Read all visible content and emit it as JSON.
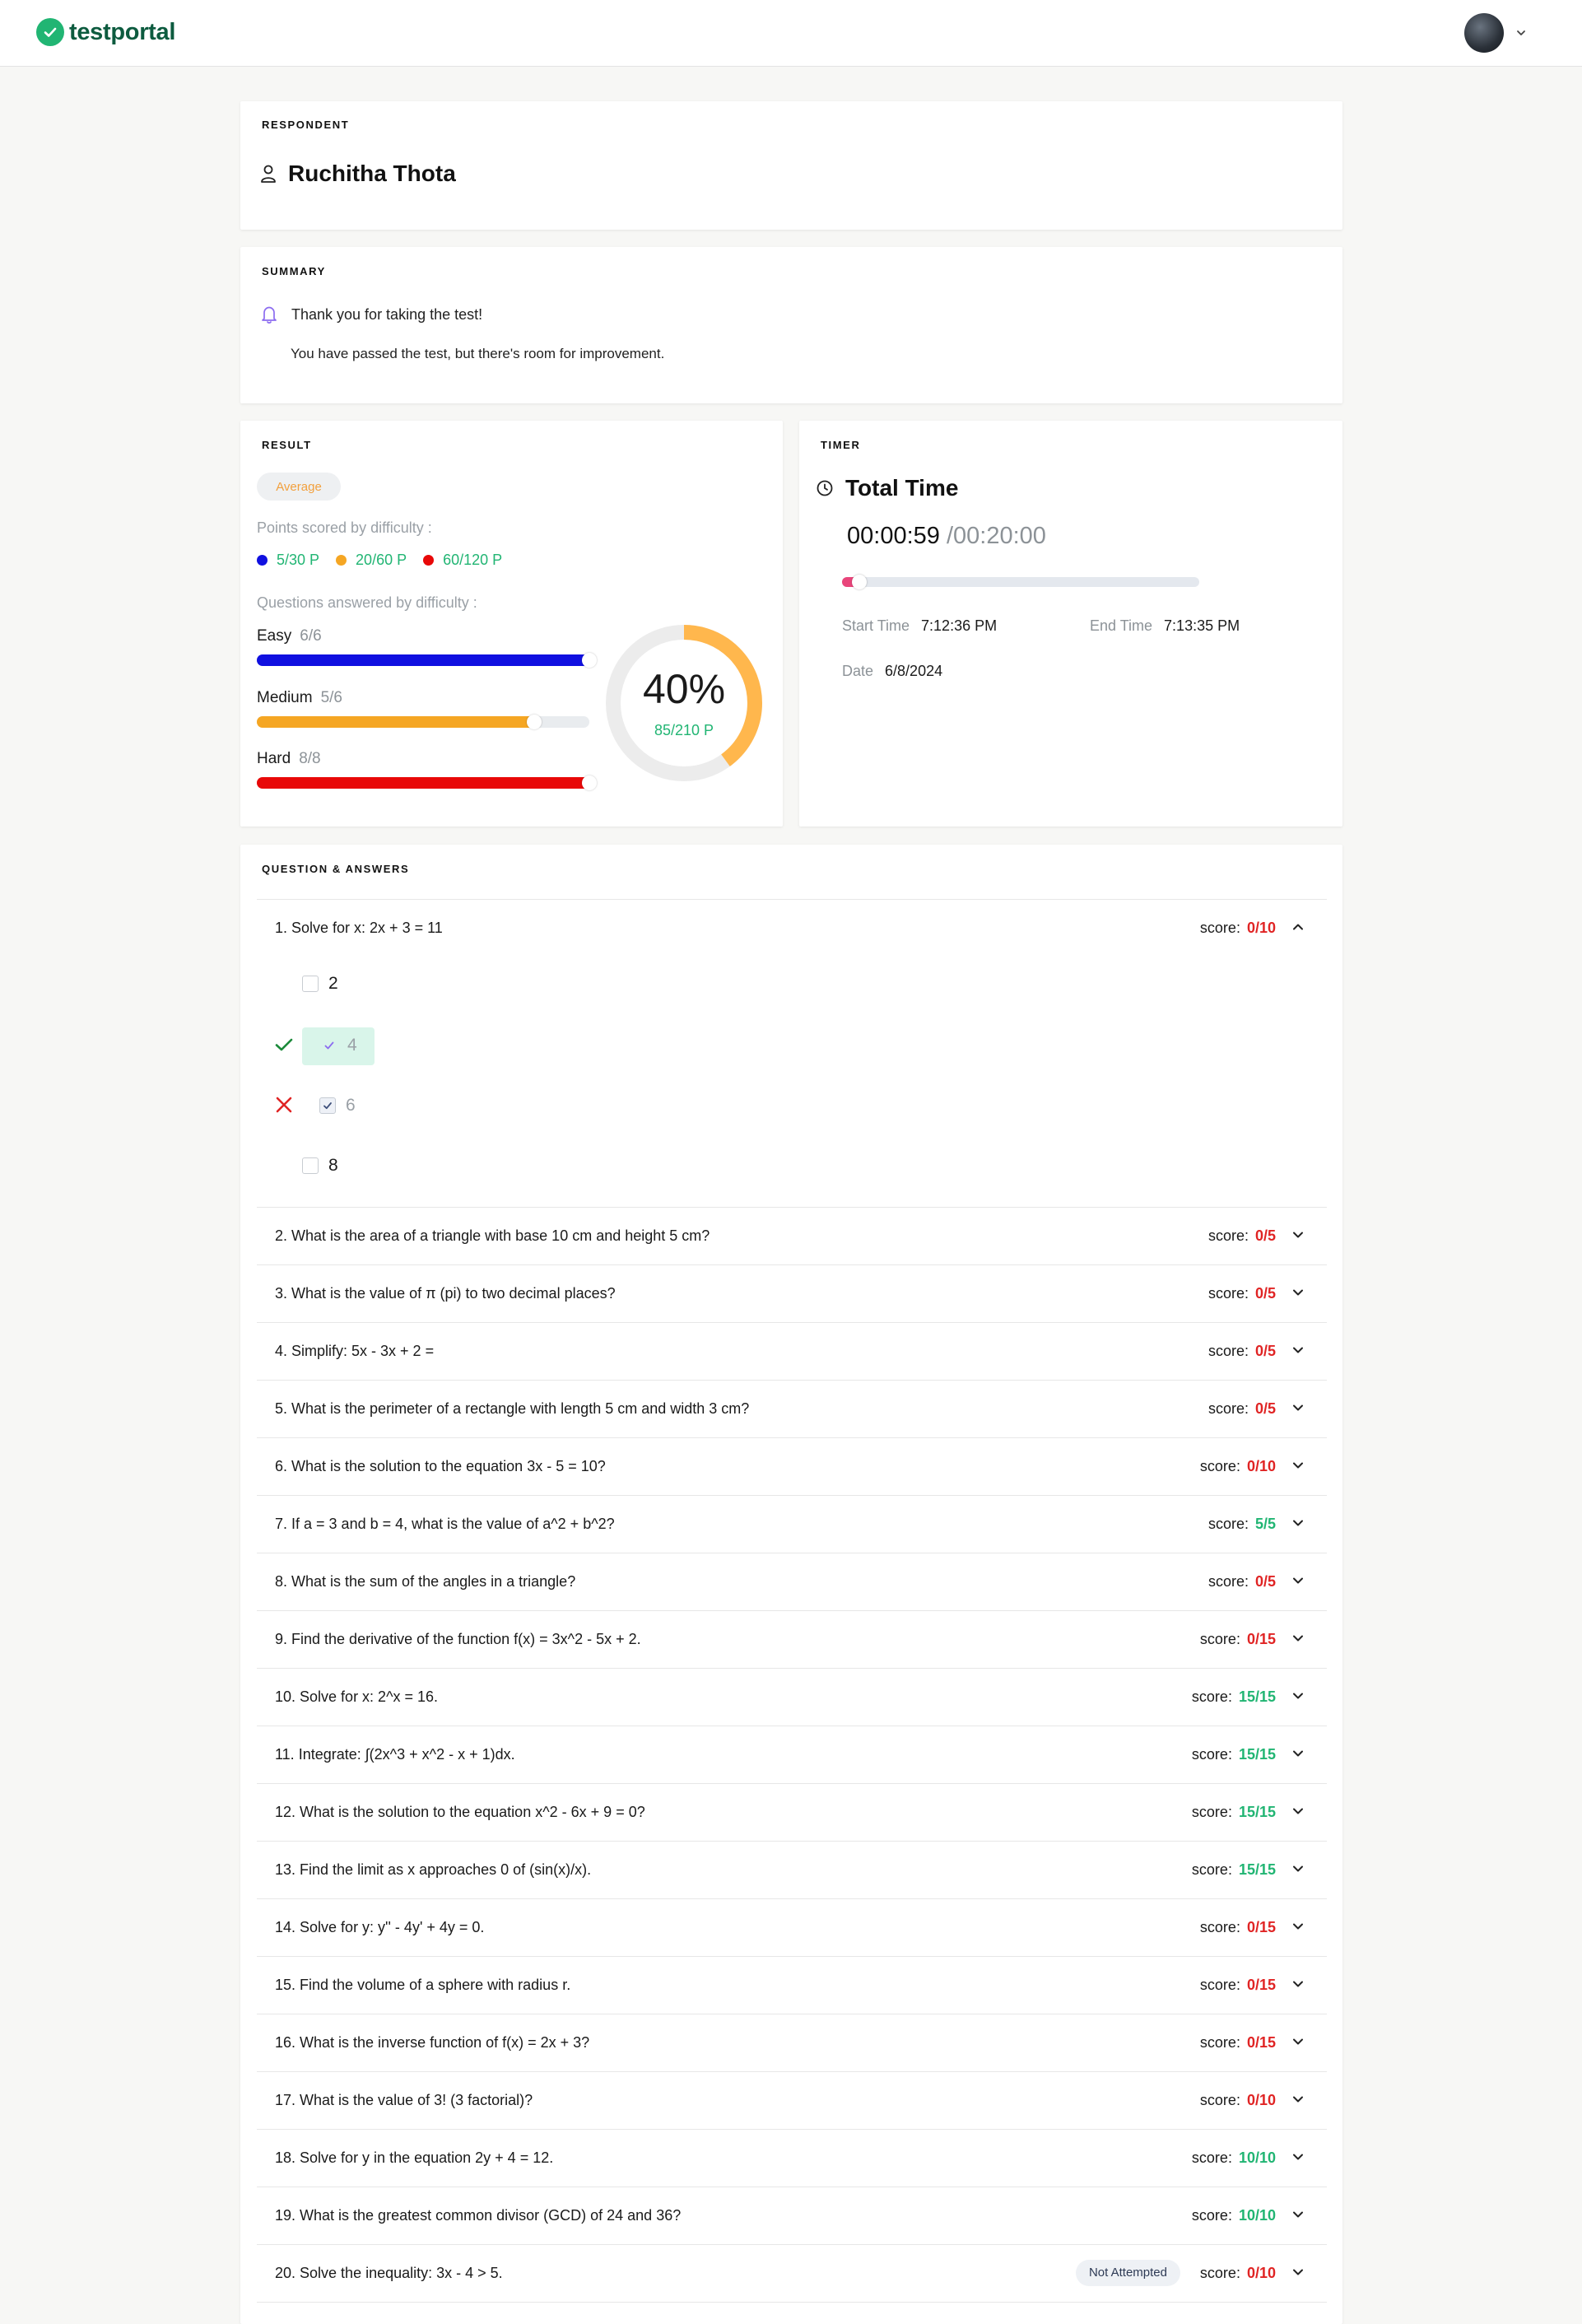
{
  "app": {
    "name": "testportal"
  },
  "respondent": {
    "label": "RESPONDENT",
    "name": "Ruchitha Thota"
  },
  "summary": {
    "label": "SUMMARY",
    "line1": "Thank you for taking the test!",
    "line2": "You have passed the test, but there's room for improvement."
  },
  "result": {
    "label": "RESULT",
    "badge": "Average",
    "points_label": "Points scored by difficulty :",
    "points": [
      {
        "value": "5/30 P",
        "color": "#1010e0"
      },
      {
        "value": "20/60 P",
        "color": "#f5a623"
      },
      {
        "value": "60/120 P",
        "color": "#e80808"
      }
    ],
    "questions_label": "Questions answered by difficulty :",
    "difficulties": [
      {
        "name": "Easy",
        "fraction": "6/6",
        "progress": 1.0,
        "color": "#1010e0"
      },
      {
        "name": "Medium",
        "fraction": "5/6",
        "progress": 0.833,
        "color": "#f5a623"
      },
      {
        "name": "Hard",
        "fraction": "8/8",
        "progress": 1.0,
        "color": "#e80808"
      }
    ],
    "percent": "40%",
    "percent_value": 0.4,
    "points_total": "85/210 P",
    "donut_color": "#ffb74d"
  },
  "timer": {
    "label": "TIMER",
    "title": "Total Time",
    "elapsed": "00:00:59",
    "total": "/00:20:00",
    "start_label": "Start Time",
    "start_value": "7:12:36 PM",
    "end_label": "End Time",
    "end_value": "7:13:35 PM",
    "date_label": "Date",
    "date_value": "6/8/2024"
  },
  "qa": {
    "label": "QUESTION & ANSWERS",
    "score_label": "score:",
    "not_attempted": "Not Attempted",
    "q1_options": [
      "2",
      "4",
      "6",
      "8"
    ],
    "questions": [
      {
        "text": "1. Solve for x: 2x + 3 = 11",
        "score": "0/10",
        "state": "red"
      },
      {
        "text": "2. What is the area of a triangle with base 10 cm and height 5 cm?",
        "score": "0/5",
        "state": "red"
      },
      {
        "text": "3. What is the value of π (pi) to two decimal places?",
        "score": "0/5",
        "state": "red"
      },
      {
        "text": "4. Simplify: 5x - 3x + 2 =",
        "score": "0/5",
        "state": "red"
      },
      {
        "text": "5. What is the perimeter of a rectangle with length 5 cm and width 3 cm?",
        "score": "0/5",
        "state": "red"
      },
      {
        "text": "6. What is the solution to the equation 3x - 5 = 10?",
        "score": "0/10",
        "state": "red"
      },
      {
        "text": "7. If a = 3 and b = 4, what is the value of a^2 + b^2?",
        "score": "5/5",
        "state": "green"
      },
      {
        "text": "8. What is the sum of the angles in a triangle?",
        "score": "0/5",
        "state": "red"
      },
      {
        "text": "9. Find the derivative of the function f(x) = 3x^2 - 5x + 2.",
        "score": "0/15",
        "state": "red"
      },
      {
        "text": "10. Solve for x: 2^x = 16.",
        "score": "15/15",
        "state": "green"
      },
      {
        "text": "11. Integrate: ∫(2x^3 + x^2 - x + 1)dx.",
        "score": "15/15",
        "state": "green"
      },
      {
        "text": "12. What is the solution to the equation x^2 - 6x + 9 = 0?",
        "score": "15/15",
        "state": "green"
      },
      {
        "text": "13. Find the limit as x approaches 0 of (sin(x)/x).",
        "score": "15/15",
        "state": "green"
      },
      {
        "text": "14. Solve for y: y'' - 4y' + 4y = 0.",
        "score": "0/15",
        "state": "red"
      },
      {
        "text": "15. Find the volume of a sphere with radius r.",
        "score": "0/15",
        "state": "red"
      },
      {
        "text": "16. What is the inverse function of f(x) = 2x + 3?",
        "score": "0/15",
        "state": "red"
      },
      {
        "text": "17. What is the value of 3! (3 factorial)?",
        "score": "0/10",
        "state": "red"
      },
      {
        "text": "18. Solve for y in the equation 2y + 4 = 12.",
        "score": "10/10",
        "state": "green"
      },
      {
        "text": "19. What is the greatest common divisor (GCD) of 24 and 36?",
        "score": "10/10",
        "state": "green"
      },
      {
        "text": "20. Solve the inequality: 3x - 4 > 5.",
        "score": "0/10",
        "state": "red"
      }
    ]
  }
}
